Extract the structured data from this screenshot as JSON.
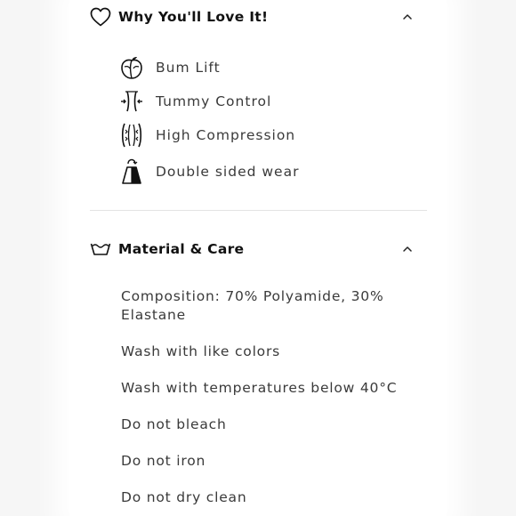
{
  "why_section": {
    "title": "Why You'll Love It!",
    "icon": "heart-icon",
    "expanded": true,
    "features": [
      {
        "label": "Bum Lift",
        "icon": "peach-icon"
      },
      {
        "label": "Tummy Control",
        "icon": "waist-icon"
      },
      {
        "label": "High Compression",
        "icon": "compression-icon"
      },
      {
        "label": "Double sided wear",
        "icon": "reversible-garment-icon"
      }
    ]
  },
  "material_section": {
    "title": "Material & Care",
    "icon": "washing-tub-icon",
    "expanded": true,
    "lines": [
      "Composition: 70% Polyamide, 30% Elastane",
      "Wash with like colors",
      "Wash with temperatures below 40°C",
      "Do not bleach",
      "Do not iron",
      "Do not dry clean"
    ]
  }
}
